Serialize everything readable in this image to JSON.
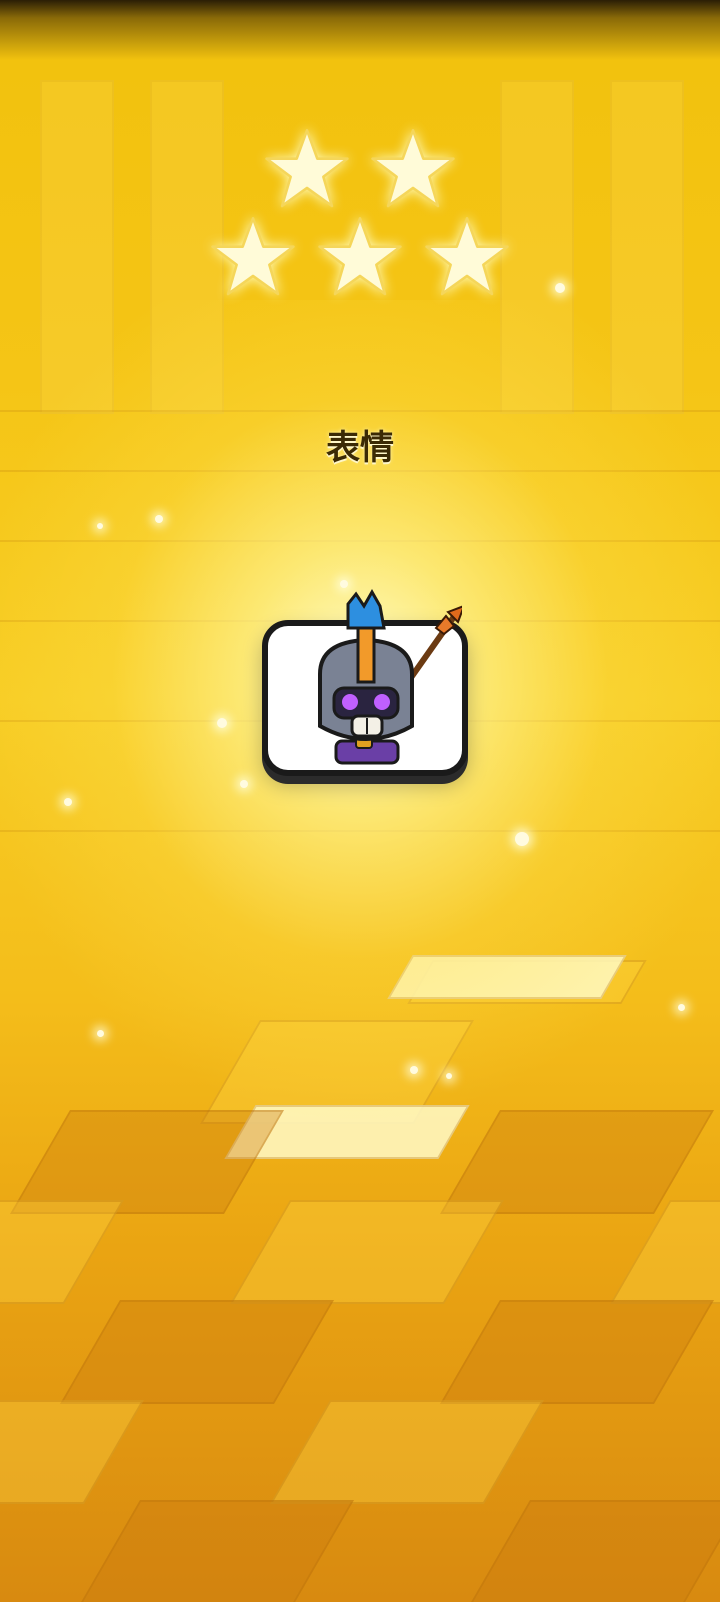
{
  "reward": {
    "title": "表情",
    "stars_earned": 5,
    "stars_total": 5,
    "item_icon": "skeleton-knight-arrow-emote"
  },
  "colors": {
    "background_gold": "#f5c516",
    "star": "#fffbd8",
    "title_text": "#3b2a05",
    "card_border": "#1a1a1a"
  }
}
